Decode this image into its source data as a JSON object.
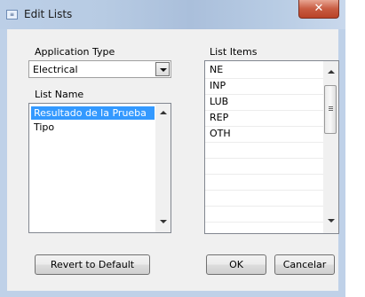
{
  "window": {
    "title": "Edit Lists",
    "close_glyph": "✕",
    "app_icon": "edit-lists-icon"
  },
  "application_type": {
    "label": "Application Type",
    "value": "Electrical"
  },
  "list_name": {
    "label": "List Name",
    "items": [
      "Resultado de la Prueba",
      "Tipo"
    ],
    "selected_index": 0
  },
  "list_items": {
    "label": "List Items",
    "items": [
      "NE",
      "INP",
      "LUB",
      "REP",
      "OTH"
    ]
  },
  "buttons": {
    "revert": "Revert to Default",
    "ok": "OK",
    "cancel": "Cancelar"
  }
}
